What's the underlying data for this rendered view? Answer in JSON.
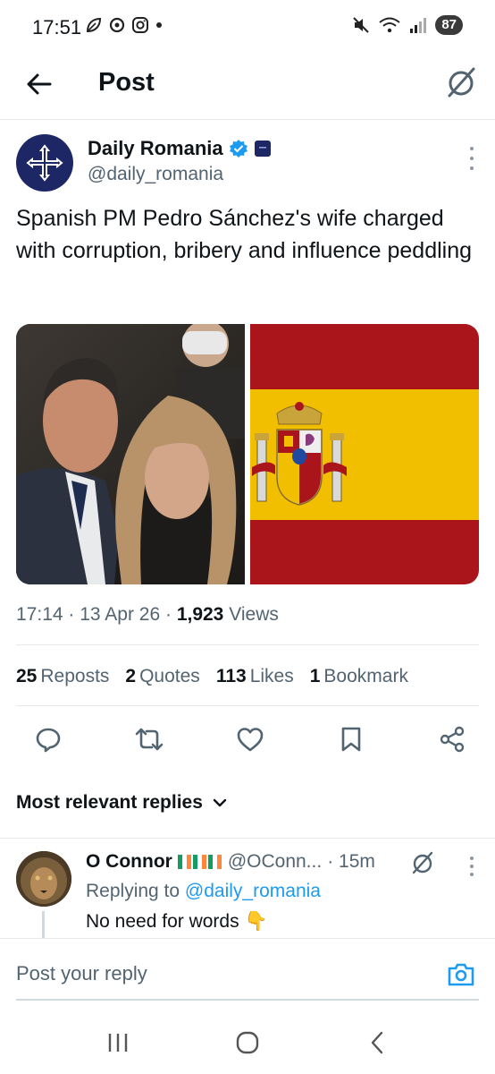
{
  "status_bar": {
    "time": "17:51",
    "battery": "87"
  },
  "header": {
    "title": "Post"
  },
  "post": {
    "author_name": "Daily Romania",
    "author_handle": "@daily_romania",
    "text": "Spanish PM Pedro Sánchez's wife charged with corruption, bribery and influence peddling",
    "time": "17:14",
    "date": "13 Apr 26",
    "views_count": "1,923",
    "views_label": "Views",
    "stats": {
      "reposts_count": "25",
      "reposts_label": "Reposts",
      "quotes_count": "2",
      "quotes_label": "Quotes",
      "likes_count": "113",
      "likes_label": "Likes",
      "bookmarks_count": "1",
      "bookmarks_label": "Bookmark"
    }
  },
  "replies_section": {
    "label": "Most relevant replies"
  },
  "reply": {
    "name": "O Connor",
    "handle": "@OConn...",
    "time": "· 15m",
    "replying_prefix": "Replying to",
    "replying_to": "@daily_romania",
    "text": "No need for words",
    "emoji": "👇"
  },
  "composer": {
    "placeholder": "Post your reply"
  },
  "colors": {
    "accent": "#1d9bf0",
    "verified": "#1d9bf0",
    "flag_red": "#aa151b",
    "flag_yellow": "#f1bf00"
  }
}
